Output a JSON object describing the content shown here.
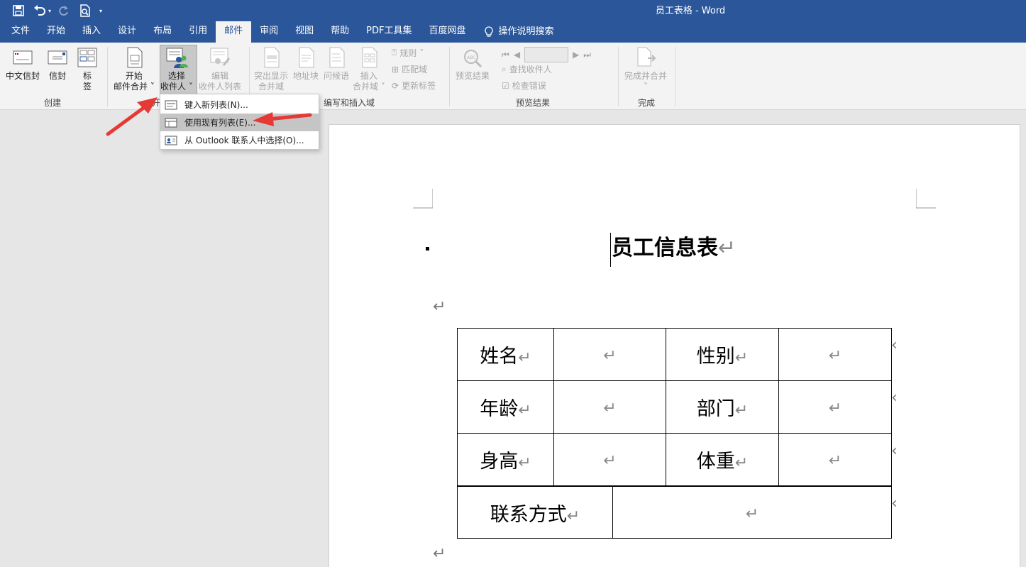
{
  "window": {
    "title": "员工表格 - Word"
  },
  "qat": {
    "save_icon": "save-icon",
    "undo_icon": "undo-icon",
    "redo_icon": "redo-icon",
    "preview_icon": "print-preview-icon"
  },
  "tabs": [
    {
      "label": "文件"
    },
    {
      "label": "开始"
    },
    {
      "label": "插入"
    },
    {
      "label": "设计"
    },
    {
      "label": "布局"
    },
    {
      "label": "引用"
    },
    {
      "label": "邮件"
    },
    {
      "label": "审阅"
    },
    {
      "label": "视图"
    },
    {
      "label": "帮助"
    },
    {
      "label": "PDF工具集"
    },
    {
      "label": "百度网盘"
    }
  ],
  "search": {
    "label": "操作说明搜索"
  },
  "ribbon": {
    "create": {
      "chinese_envelope": "中文信封",
      "envelope": "信封",
      "label_1": "标",
      "label_2": "签",
      "group": "创建"
    },
    "start_merge": {
      "start_1": "开始",
      "start_2": "邮件合并",
      "select_1": "选择",
      "select_2": "收件人",
      "edit_1": "编辑",
      "edit_2": "收件人列表",
      "group": "开"
    },
    "write_insert": {
      "highlight_1": "突出显示",
      "highlight_2": "合并域",
      "address_block": "地址块",
      "greeting": "问候语",
      "insert_1": "插入",
      "insert_2": "合并域",
      "rules": "规则",
      "match_fields": "匹配域",
      "update_labels": "更新标签",
      "group": "编写和插入域"
    },
    "preview": {
      "preview_results": "预览结果",
      "find_recipient": "查找收件人",
      "check_errors": "检查错误",
      "group": "预览结果"
    },
    "finish": {
      "finish_merge": "完成并合并",
      "group": "完成"
    }
  },
  "dropdown": {
    "items": [
      {
        "label": "键入新列表(N)..."
      },
      {
        "label": "使用现有列表(E)..."
      },
      {
        "label": "从 Outlook 联系人中选择(O)..."
      }
    ]
  },
  "document": {
    "heading": "员工信息表",
    "para_mark": "↵",
    "table": {
      "rows": [
        [
          "姓名",
          "",
          "性别",
          ""
        ],
        [
          "年龄",
          "",
          "部门",
          ""
        ],
        [
          "身高",
          "",
          "体重",
          ""
        ]
      ],
      "last_row": [
        "联系方式",
        ""
      ]
    }
  },
  "colors": {
    "title_bar": "#2b579a",
    "annotation_arrow": "#e53935"
  }
}
